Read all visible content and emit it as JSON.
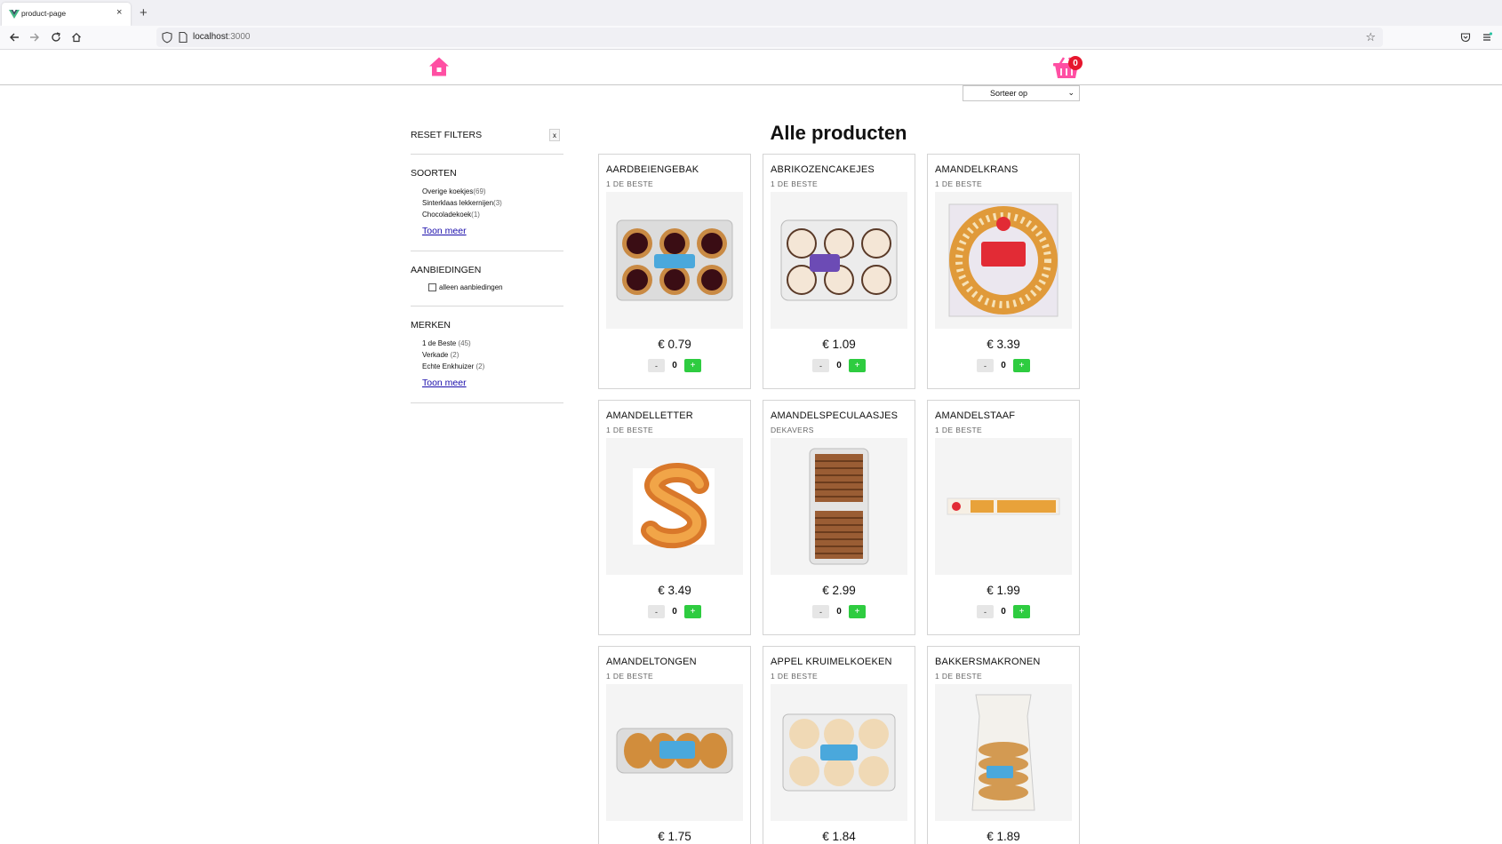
{
  "browser": {
    "tab_title": "product-page",
    "tab_close": "×",
    "new_tab": "+",
    "url_host": "localhost",
    "url_port": ":3000"
  },
  "header": {
    "cart_count": "0",
    "sort_label": "Sorteer op",
    "brand_color": "#ff4fa3"
  },
  "sidebar": {
    "reset_label": "RESET FILTERS",
    "reset_x": "x",
    "soorten_heading": "SOORTEN",
    "soorten": [
      {
        "label": "Overige koekjes",
        "count": "(69)"
      },
      {
        "label": "Sinterklaas lekkernijen",
        "count": "(3)"
      },
      {
        "label": "Chocoladekoek",
        "count": "(1)"
      }
    ],
    "show_more": "Toon meer",
    "aanbiedingen_heading": "AANBIEDINGEN",
    "aanbiedingen_checkbox": "alleen aanbiedingen",
    "merken_heading": "MERKEN",
    "merken": [
      {
        "label": "1 de Beste",
        "count": " (45)"
      },
      {
        "label": "Verkade",
        "count": " (2)"
      },
      {
        "label": "Echte Enkhuizer",
        "count": " (2)"
      }
    ]
  },
  "main": {
    "title": "Alle producten",
    "products": [
      {
        "name": "AARDBEIENGEBAK",
        "brand": "1 DE BESTE",
        "price": "€ 0.79",
        "qty": "0",
        "minus": "-",
        "plus": "+"
      },
      {
        "name": "ABRIKOZENCAKEJES",
        "brand": "1 DE BESTE",
        "price": "€ 1.09",
        "qty": "0",
        "minus": "-",
        "plus": "+"
      },
      {
        "name": "AMANDELKRANS",
        "brand": "1 DE BESTE",
        "price": "€ 3.39",
        "qty": "0",
        "minus": "-",
        "plus": "+"
      },
      {
        "name": "AMANDELLETTER",
        "brand": "1 DE BESTE",
        "price": "€ 3.49",
        "qty": "0",
        "minus": "-",
        "plus": "+"
      },
      {
        "name": "AMANDELSPECULAASJES",
        "brand": "DEKAVERS",
        "price": "€ 2.99",
        "qty": "0",
        "minus": "-",
        "plus": "+"
      },
      {
        "name": "AMANDELSTAAF",
        "brand": "1 DE BESTE",
        "price": "€ 1.99",
        "qty": "0",
        "minus": "-",
        "plus": "+"
      },
      {
        "name": "AMANDELTONGEN",
        "brand": "1 DE BESTE",
        "price": "€ 1.75",
        "qty": "0",
        "minus": "-",
        "plus": "+"
      },
      {
        "name": "APPEL KRUIMELKOEKEN",
        "brand": "1 DE BESTE",
        "price": "€ 1.84",
        "qty": "0",
        "minus": "-",
        "plus": "+"
      },
      {
        "name": "BAKKERSMAKRONEN",
        "brand": "1 DE BESTE",
        "price": "€ 1.89",
        "qty": "0",
        "minus": "-",
        "plus": "+"
      }
    ]
  }
}
